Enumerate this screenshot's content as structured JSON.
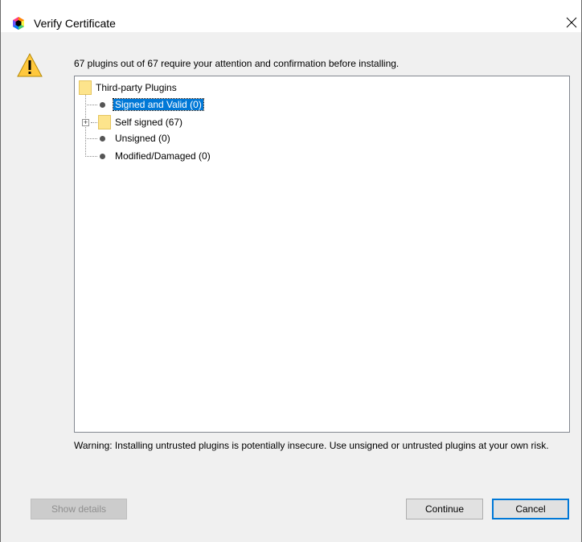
{
  "window": {
    "title": "Verify Certificate"
  },
  "message": "67 plugins out of 67 require your attention and confirmation before installing.",
  "tree": {
    "root": "Third-party Plugins",
    "items": [
      {
        "label": "Signed and Valid (0)",
        "selected": true
      },
      {
        "label": "Self signed (67)",
        "expandable": true
      },
      {
        "label": "Unsigned (0)"
      },
      {
        "label": "Modified/Damaged (0)"
      }
    ]
  },
  "warning": "Warning: Installing untrusted plugins is potentially insecure. Use unsigned or untrusted plugins at your own risk.",
  "buttons": {
    "show_details": "Show details",
    "continue": "Continue",
    "cancel": "Cancel"
  },
  "colors": {
    "selection": "#0078d7",
    "folder": "#fde48c",
    "warning_icon": "#ffc83d"
  },
  "icons": {
    "app": "jetbrains-hexagon-icon",
    "warning": "warning-triangle-icon",
    "close": "close-icon",
    "folder": "folder-icon",
    "node": "bullet-icon",
    "expander": "plus-expander-icon"
  }
}
